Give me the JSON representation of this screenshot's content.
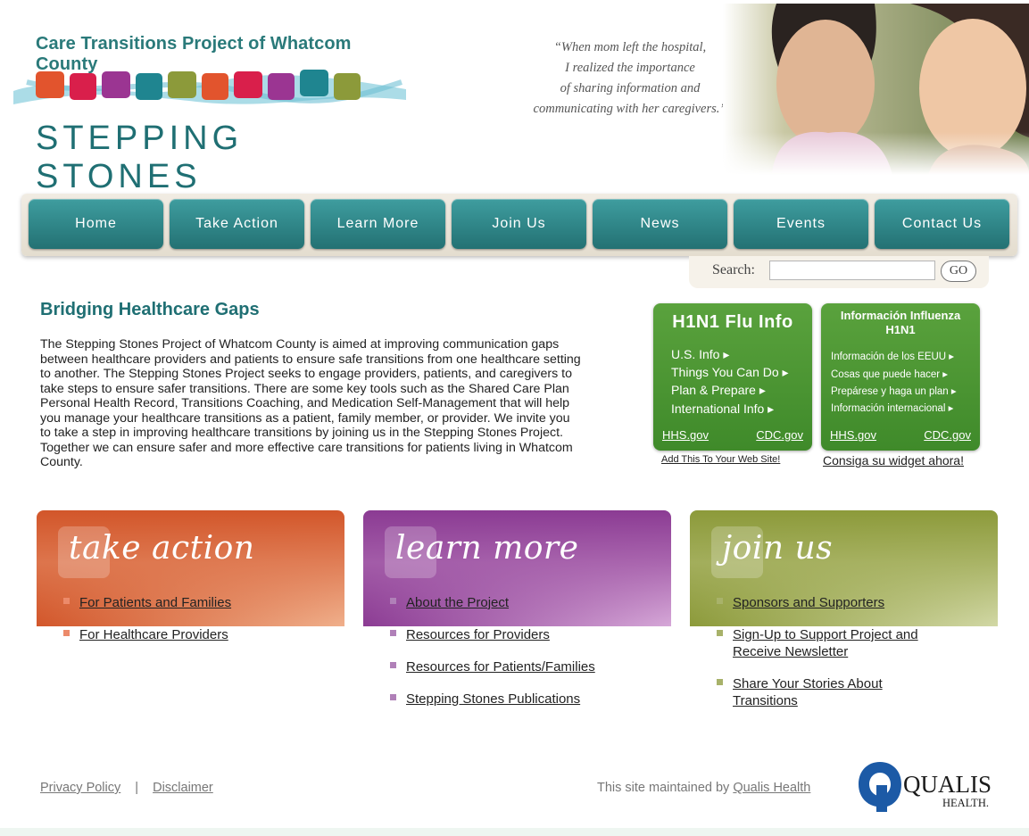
{
  "header": {
    "logo_title": "Care Transitions Project of Whatcom County",
    "logo_name": "STEPPING STONES",
    "quote_lines": [
      "“When mom left the hospital,",
      "I realized the importance",
      "of sharing information and",
      "communicating with her caregivers.”"
    ]
  },
  "nav": {
    "items": [
      "Home",
      "Take Action",
      "Learn More",
      "Join Us",
      "News",
      "Events",
      "Contact Us"
    ]
  },
  "search": {
    "label": "Search:",
    "value": "",
    "go_label": "GO"
  },
  "intro": {
    "title": "Bridging Healthcare Gaps",
    "lines": [
      "The Stepping Stones Project of Whatcom County is aimed at improving communication gaps",
      "between healthcare providers and patients to ensure safe transitions from one healthcare setting",
      "to another. The Stepping Stones Project seeks to engage providers, patients, and caregivers to",
      "take steps to ensure safer transitions. There are some key tools such as the Shared Care Plan",
      "Personal Health Record, Transitions Coaching, and Medication Self-Management that will help",
      "you manage your healthcare transitions as a patient, family member, or provider. We invite you",
      "to take a step in improving healthcare transitions by joining us in the Stepping Stones Project.",
      "Together we can ensure safer and more effective care transitions for patients living in Whatcom",
      "County."
    ]
  },
  "widget_en": {
    "title": "H1N1 Flu Info",
    "links": [
      "U.S. Info ▸",
      "Things You Can Do ▸",
      "Plan & Prepare ▸",
      "International Info ▸"
    ],
    "footer_left": "HHS.gov",
    "footer_right": "CDC.gov",
    "below": "Add This To Your Web Site!"
  },
  "widget_es": {
    "title_line1": "Información Influenza",
    "title_line2": "H1N1",
    "links": [
      "Información de los EEUU ▸",
      "Cosas que puede hacer ▸",
      "Prepárese y haga un plan ▸",
      "Información internacional ▸"
    ],
    "footer_left": "HHS.gov",
    "footer_right": "CDC.gov",
    "below": "Consiga su widget ahora!"
  },
  "panels": {
    "take_action": {
      "title": "take action",
      "items": [
        "For Patients and Families",
        "For Healthcare Providers"
      ]
    },
    "learn_more": {
      "title": "learn more",
      "items": [
        "About the Project",
        "Resources for Providers",
        "Resources for Patients/Families",
        "Stepping Stones Publications"
      ]
    },
    "join_us": {
      "title": "join us",
      "items": [
        "Sponsors and Supporters",
        "Sign-Up to Support Project and Receive Newsletter",
        "Share Your Stories About Transitions"
      ]
    }
  },
  "footer": {
    "privacy": "Privacy Policy",
    "separator": "|",
    "disclaimer": "Disclaimer",
    "maintained_prefix": "This site maintained by",
    "maintained_link": "Qualis Health",
    "logo_text_1": "QUALIS",
    "logo_text_2": "HEALTH."
  },
  "colors": {
    "teal": "#2f8587",
    "green_widget": "#4a962f",
    "orange_panel": "#d2562a",
    "purple_panel": "#8b3b93",
    "olive_panel": "#8c9a3a"
  }
}
